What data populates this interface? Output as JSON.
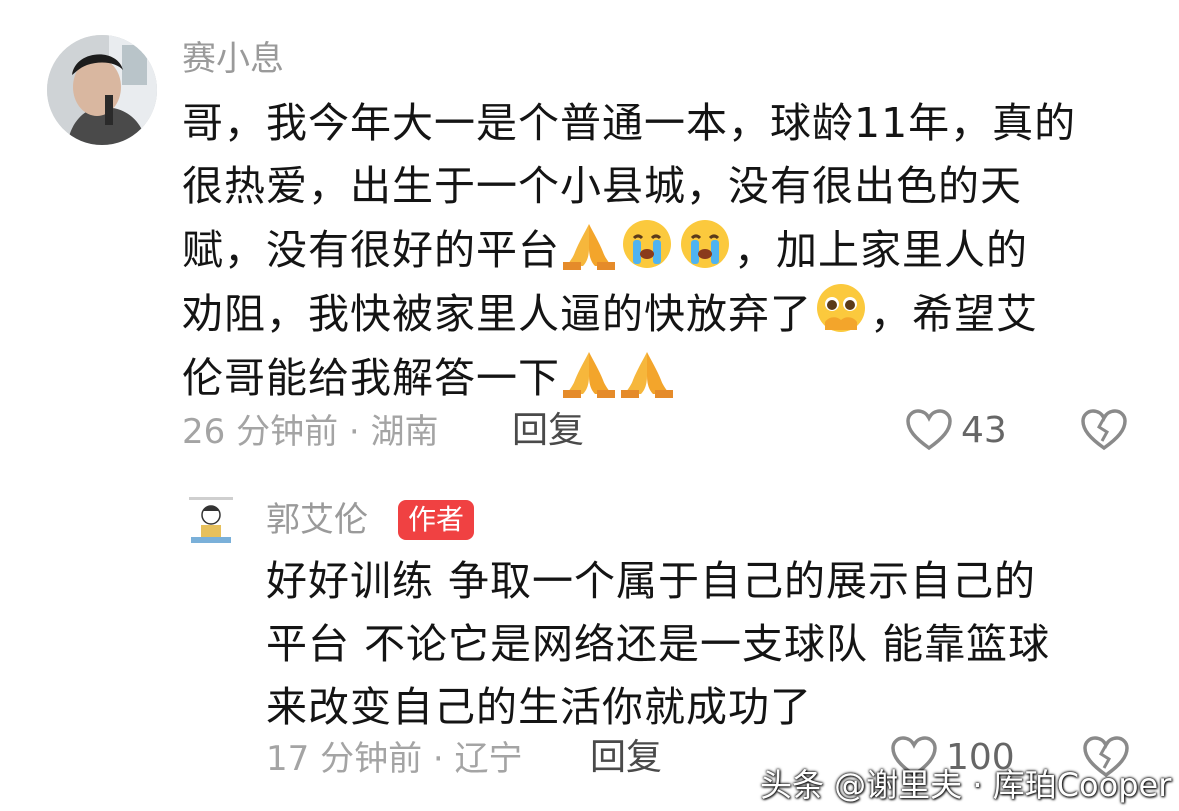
{
  "comment": {
    "username": "赛小息",
    "lines": [
      "哥，我今年大一是个普通一本，球龄11年，真的",
      "很热爱，出生于一个小县城，没有很出色的天",
      "赋，没有很好的平台",
      "，加上家里人的",
      "劝阻，我快被家里人逼的快放弃了",
      "，希望艾",
      "伦哥能给我解答一下"
    ],
    "time_location": "26 分钟前 · 湖南",
    "reply_label": "回复",
    "likes": "43"
  },
  "reply": {
    "username": "郭艾伦",
    "badge": "作者",
    "lines": [
      "好好训练 争取一个属于自己的展示自己的",
      "平台 不论它是网络还是一支球队 能靠篮球",
      "来改变自己的生活你就成功了"
    ],
    "time_location": "17 分钟前 · 辽宁",
    "reply_label": "回复",
    "likes": "100"
  },
  "watermark": "头条 @谢里夫 · 库珀Cooper",
  "colors": {
    "badge": "#f04142",
    "meta": "#a4a4a4",
    "text": "#141414"
  }
}
